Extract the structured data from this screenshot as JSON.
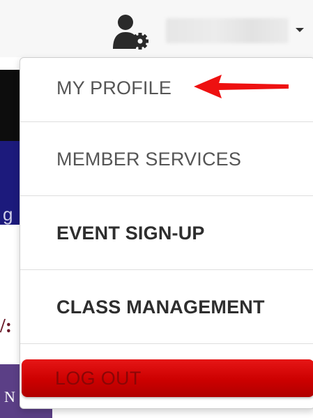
{
  "header": {
    "user_icon": "user-settings-icon",
    "dropdown_icon": "caret-down-icon"
  },
  "background": {
    "navy_fragment": "g",
    "maroon_fragment": "/:",
    "purple_fragment": "N"
  },
  "menu": {
    "items": [
      {
        "label": "MY PROFILE"
      },
      {
        "label": "MEMBER SERVICES"
      },
      {
        "label": "EVENT SIGN-UP"
      },
      {
        "label": "CLASS MANAGEMENT"
      }
    ],
    "logout_label": "LOG OUT"
  },
  "annotation": {
    "arrow_icon": "red-arrow-left-icon",
    "arrow_color": "#ee1111"
  },
  "colors": {
    "logout_red": "#cc0000",
    "menu_text": "#555555"
  }
}
